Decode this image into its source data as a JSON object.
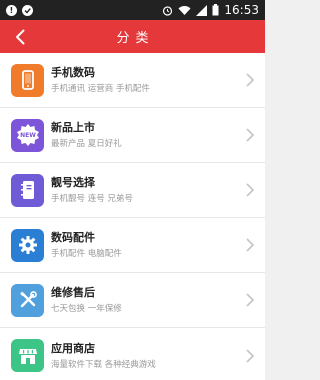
{
  "status_bar": {
    "time": "16:53"
  },
  "header": {
    "title": "分类"
  },
  "categories": [
    {
      "title": "手机数码",
      "subtitle": "手机通讯  运营商  手机配件",
      "color": "#f07b2a",
      "icon": "phone-icon"
    },
    {
      "title": "新品上市",
      "subtitle": "最新产品  夏日好礼",
      "color": "#7c55d9",
      "icon": "new-badge-icon"
    },
    {
      "title": "靓号选择",
      "subtitle": "手机靓号  连号  兄弟号",
      "color": "#6f5bd6",
      "icon": "notebook-icon"
    },
    {
      "title": "数码配件",
      "subtitle": "手机配件  电脑配件",
      "color": "#2a7fd4",
      "icon": "gear-icon"
    },
    {
      "title": "维修售后",
      "subtitle": "七天包换  一年保修",
      "color": "#4fa0dc",
      "icon": "tools-icon"
    },
    {
      "title": "应用商店",
      "subtitle": "海量软件下载  各种经典游戏",
      "color": "#3dc487",
      "icon": "store-icon"
    }
  ]
}
